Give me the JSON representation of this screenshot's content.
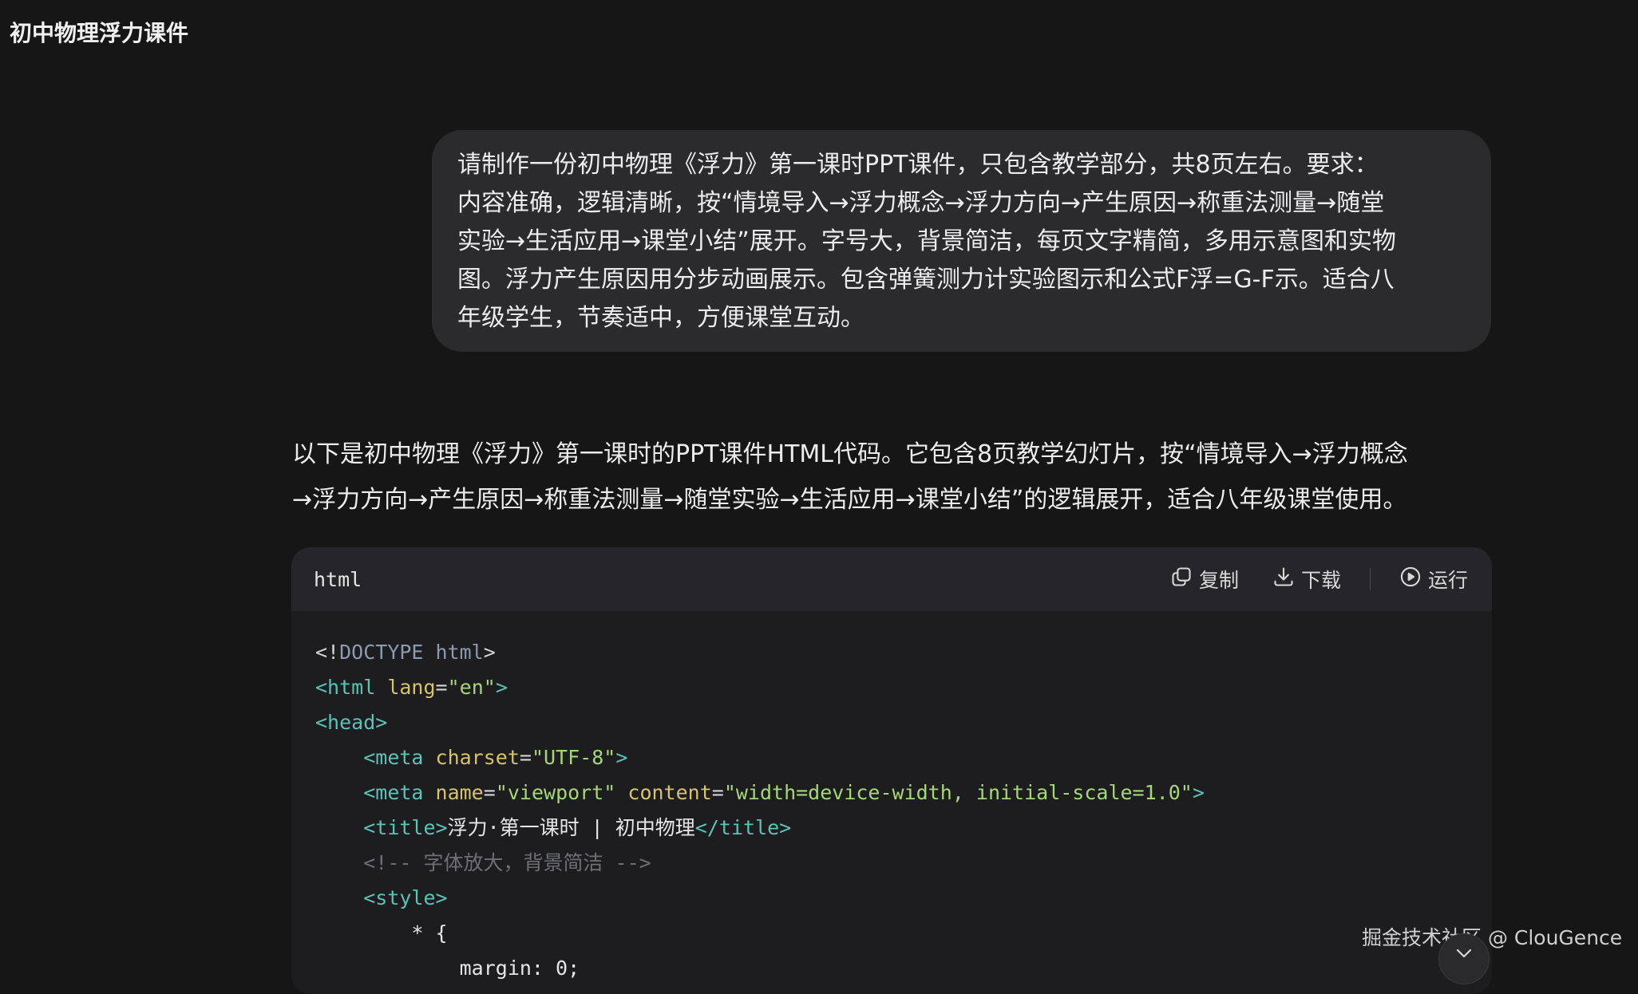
{
  "page": {
    "title": "初中物理浮力课件"
  },
  "user_message": {
    "lines": [
      "请制作一份初中物理《浮力》第一课时PPT课件，只包含教学部分，共8页左右。要求：",
      "内容准确，逻辑清晰，按“情境导入→浮力概念→浮力方向→产生原因→称重法测量→随堂",
      "实验→生活应用→课堂小结”展开。字号大，背景简洁，每页文字精简，多用示意图和实物",
      "图。浮力产生原因用分步动画展示。包含弹簧测力计实验图示和公式F浮=G-F示。适合八",
      "年级学生，节奏适中，方便课堂互动。"
    ]
  },
  "assistant_message": {
    "lines": [
      "以下是初中物理《浮力》第一课时的PPT课件HTML代码。它包含8页教学幻灯片，按“情境导入→浮力概念",
      "→浮力方向→产生原因→称重法测量→随堂实验→生活应用→课堂小结”的逻辑展开，适合八年级课堂使用。"
    ]
  },
  "code_block": {
    "language": "html",
    "copy_label": "复制",
    "download_label": "下载",
    "run_label": "运行",
    "icons": {
      "copy": "copy-icon",
      "download": "download-icon",
      "run": "play-circle-icon"
    },
    "lines": [
      [
        [
          "punct",
          "<!"
        ],
        [
          "doctype",
          "DOCTYPE html"
        ],
        [
          "punct",
          ">"
        ]
      ],
      [
        [
          "tag",
          "<html "
        ],
        [
          "attr",
          "lang"
        ],
        [
          "punct",
          "="
        ],
        [
          "str",
          "\"en\""
        ],
        [
          "tag",
          ">"
        ]
      ],
      [
        [
          "tag",
          "<head>"
        ]
      ],
      [
        [
          "text",
          "    "
        ],
        [
          "tag",
          "<meta "
        ],
        [
          "attr",
          "charset"
        ],
        [
          "punct",
          "="
        ],
        [
          "str",
          "\"UTF-8\""
        ],
        [
          "tag",
          ">"
        ]
      ],
      [
        [
          "text",
          "    "
        ],
        [
          "tag",
          "<meta "
        ],
        [
          "attr",
          "name"
        ],
        [
          "punct",
          "="
        ],
        [
          "str",
          "\"viewport\" "
        ],
        [
          "attr",
          "content"
        ],
        [
          "punct",
          "="
        ],
        [
          "str",
          "\"width=device-width, initial-scale=1.0\""
        ],
        [
          "tag",
          ">"
        ]
      ],
      [
        [
          "text",
          "    "
        ],
        [
          "tag",
          "<title>"
        ],
        [
          "text",
          "浮力·第一课时 | 初中物理"
        ],
        [
          "tag",
          "</title>"
        ]
      ],
      [
        [
          "text",
          "    "
        ],
        [
          "comment",
          "<!-- 字体放大，背景简洁 -->"
        ]
      ],
      [
        [
          "text",
          "    "
        ],
        [
          "tag",
          "<style>"
        ]
      ],
      [
        [
          "text",
          "        * {"
        ]
      ],
      [
        [
          "text",
          "            margin: 0;"
        ]
      ]
    ]
  },
  "watermark": "掘金技术社区 @ ClouGence",
  "scroll_button": {
    "icon": "chevron-down-icon"
  }
}
